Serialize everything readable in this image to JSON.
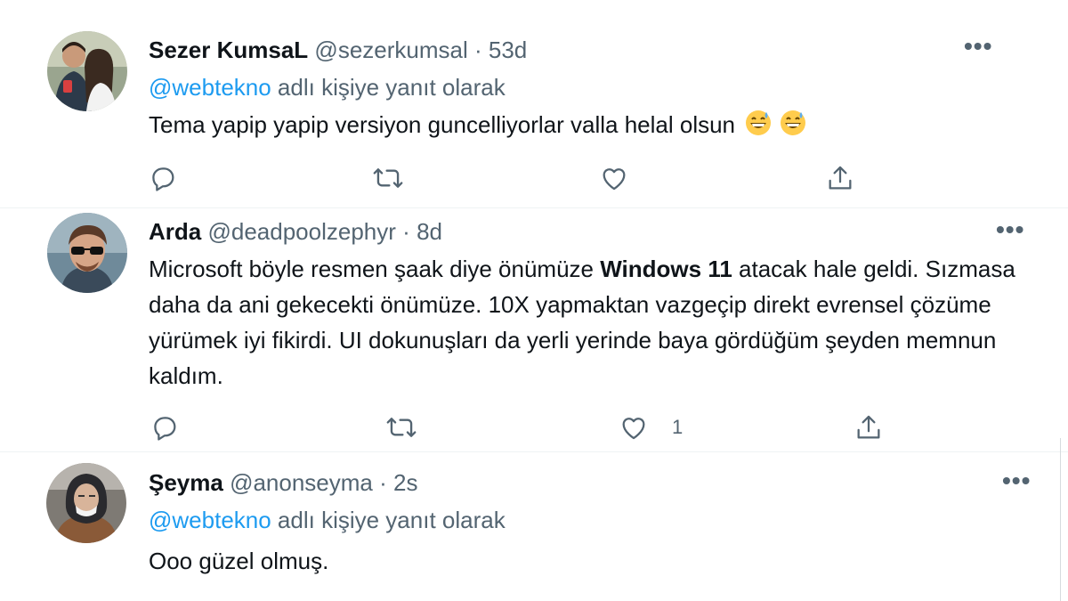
{
  "tweets": [
    {
      "name": "Sezer KumsaL",
      "handle": "@sezerkumsal",
      "sep": "·",
      "time": "53d",
      "reply_prefix": "@webtekno",
      "reply_suffix": " adlı kişiye yanıt olarak",
      "text": "Tema yapip yapip versiyon guncelliyorlar valla helal olsun",
      "emoji": "grinning-face-with-sweat-icon",
      "like_count": ""
    },
    {
      "name": "Arda",
      "handle": "@deadpoolzephyr",
      "sep": "·",
      "time": "8d",
      "text_line1_a": "Microsoft böyle resmen şaak diye önümüze ",
      "text_line1_bold": "Windows 11",
      "text_line1_b": " atacak hale geldi.",
      "text_rest": "Sızmasa daha da ani gekecekti önümüze. 10X yapmaktan vazgeçip direkt evrensel çözüme yürümek iyi fikirdi. UI dokunuşları da yerli yerinde baya gördüğüm şeyden memnun kaldım.",
      "like_count": "1"
    },
    {
      "name": "Şeyma",
      "handle": "@anonseyma",
      "sep": "·",
      "time": "2s",
      "reply_prefix": "@webtekno",
      "reply_suffix": " adlı kişiye yanıt olarak",
      "text": "Ooo güzel olmuş."
    }
  ],
  "more_label": "•••",
  "colors": {
    "accent": "#1d9bf0",
    "secondary": "#536471",
    "text": "#0f1419"
  }
}
